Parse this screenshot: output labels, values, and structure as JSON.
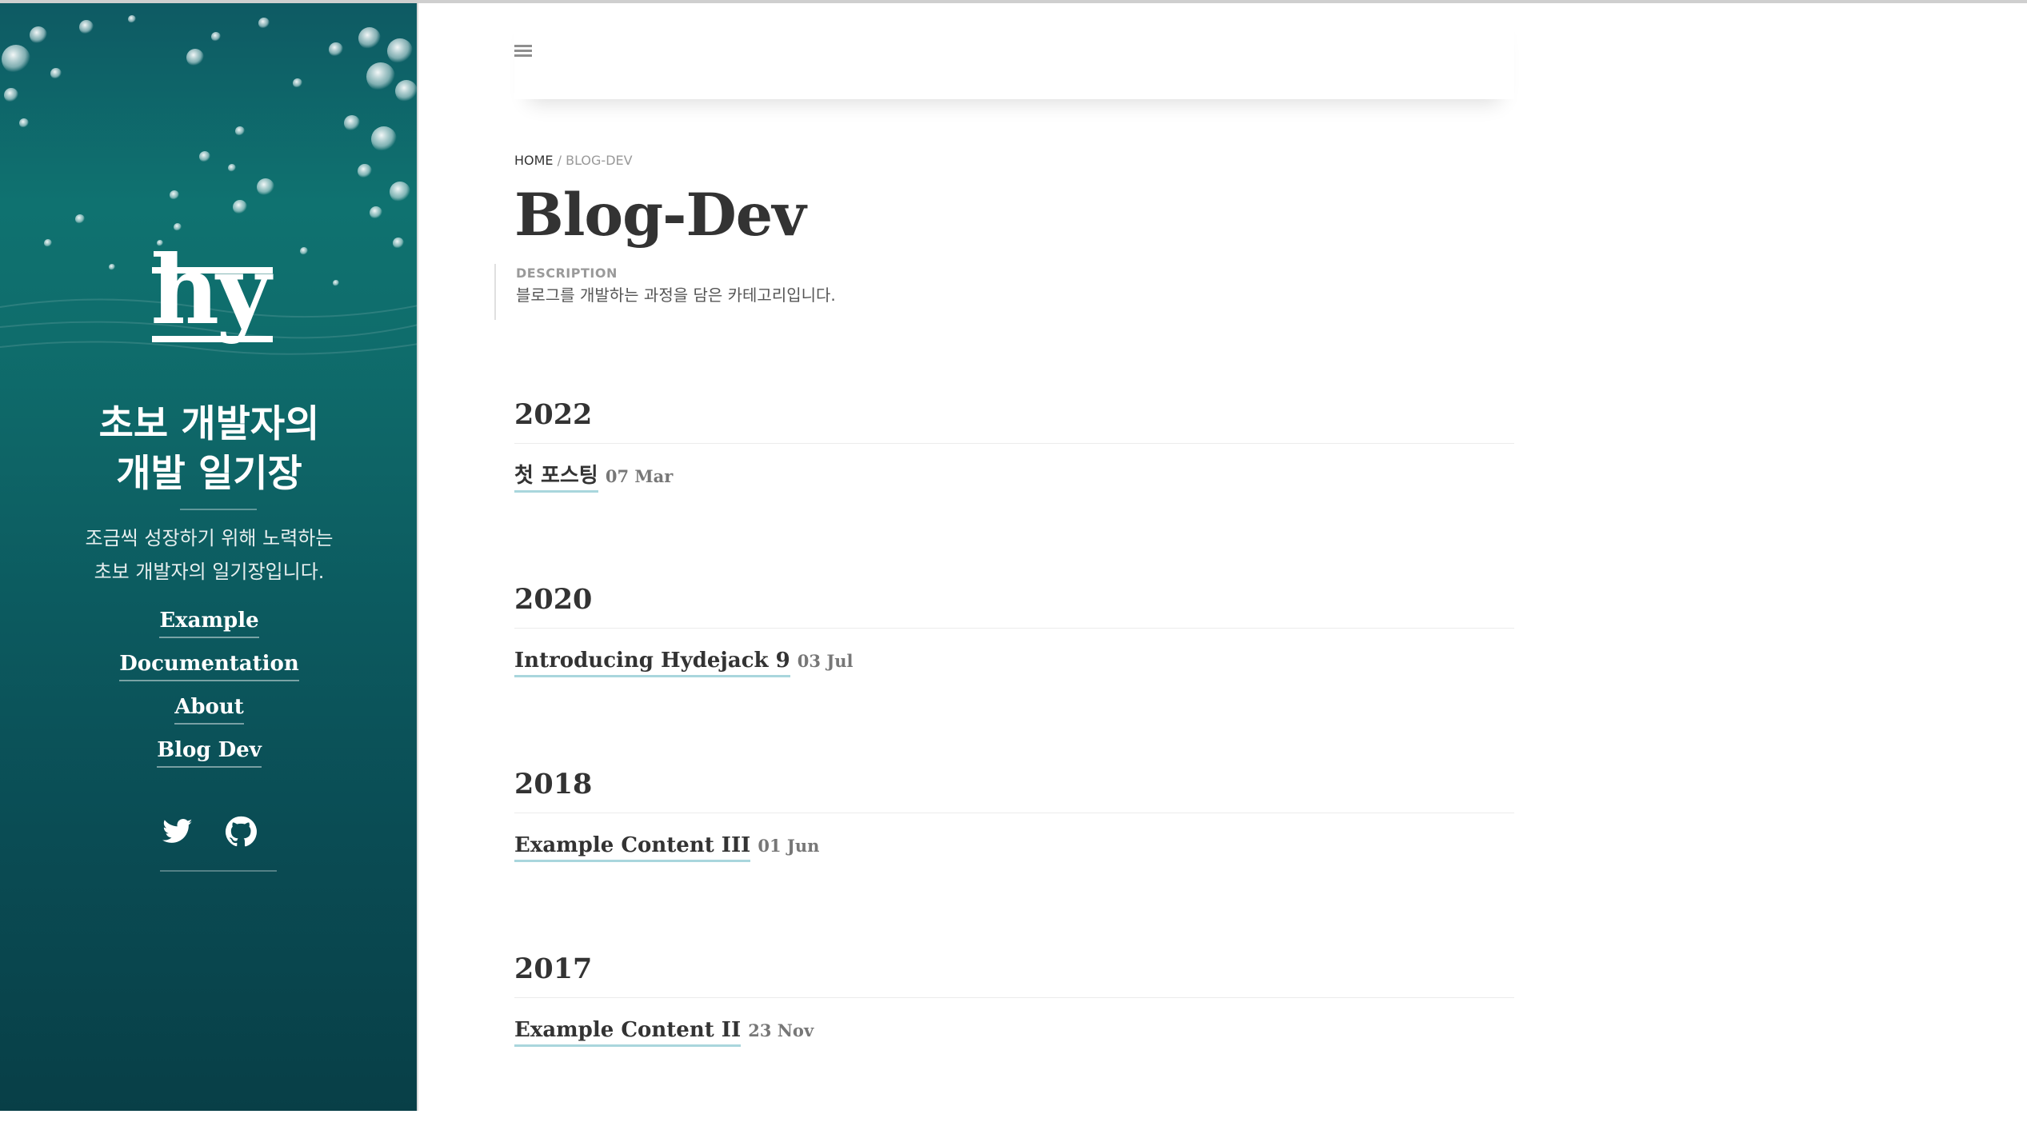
{
  "sidebar": {
    "logo_text": "hy",
    "title_line1": "초보 개발자의",
    "title_line2": "개발 일기장",
    "description_line1": "조금씩 성장하기 위해 노력하는",
    "description_line2": "초보 개발자의 일기장입니다.",
    "nav": [
      {
        "label": "Example"
      },
      {
        "label": "Documentation"
      },
      {
        "label": "About"
      },
      {
        "label": "Blog Dev"
      }
    ],
    "social": [
      {
        "icon": "twitter-icon"
      },
      {
        "icon": "github-icon"
      }
    ]
  },
  "header": {
    "menu_icon": "hamburger-menu-icon"
  },
  "breadcrumb": {
    "home": "HOME",
    "separator": " / ",
    "current": "BLOG-DEV"
  },
  "page": {
    "title": "Blog-Dev",
    "description_label": "DESCRIPTION",
    "description": "블로그를 개발하는 과정을 담은 카테고리입니다."
  },
  "archive": [
    {
      "year": "2022",
      "posts": [
        {
          "title": "첫 포스팅",
          "date": "07 Mar"
        }
      ]
    },
    {
      "year": "2020",
      "posts": [
        {
          "title": "Introducing Hydejack 9",
          "date": "03 Jul"
        }
      ]
    },
    {
      "year": "2018",
      "posts": [
        {
          "title": "Example Content III",
          "date": "01 Jun"
        }
      ]
    },
    {
      "year": "2017",
      "posts": [
        {
          "title": "Example Content II",
          "date": "23 Nov"
        }
      ]
    }
  ],
  "colors": {
    "sidebar_bg": "#0f6d6c",
    "link_underline": "#a9d6dd",
    "text": "#333333"
  }
}
